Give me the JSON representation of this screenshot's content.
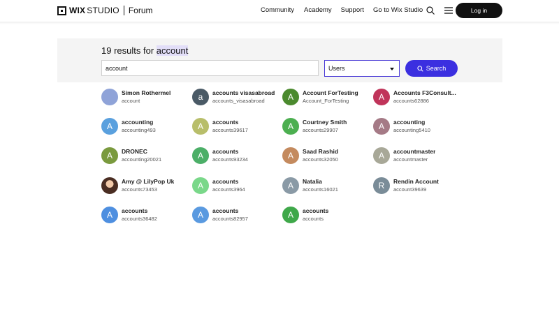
{
  "header": {
    "logo_wix": "WIX",
    "logo_studio": "STUDIO",
    "logo_forum": "Forum",
    "nav": [
      "Community",
      "Academy",
      "Support",
      "Go to Wix Studio"
    ],
    "login_label": "Log in"
  },
  "search": {
    "results_prefix": "19 results for",
    "query_highlight": "account",
    "input_value": "account",
    "select_value": "Users",
    "button_label": "Search"
  },
  "users": [
    {
      "initial": "",
      "name": "Simon Rothermel",
      "handle": "account",
      "color": "#8fa3d8"
    },
    {
      "initial": "a",
      "name": "accounts visasabroad",
      "handle": "accounts_visasabroad",
      "color": "#4a5a66"
    },
    {
      "initial": "A",
      "name": "Account ForTesting",
      "handle": "Account_ForTesting",
      "color": "#4b8a2e"
    },
    {
      "initial": "A",
      "name": "Accounts F3Consult...",
      "handle": "accounts62886",
      "color": "#c0345a"
    },
    {
      "initial": "A",
      "name": "accounting",
      "handle": "accounting493",
      "color": "#5aa0de"
    },
    {
      "initial": "A",
      "name": "accounts",
      "handle": "accounts39617",
      "color": "#b8be6a"
    },
    {
      "initial": "A",
      "name": "Courtney Smith",
      "handle": "accounts29907",
      "color": "#4caf50"
    },
    {
      "initial": "A",
      "name": "accounting",
      "handle": "accounting5410",
      "color": "#a57a86"
    },
    {
      "initial": "A",
      "name": "DRONEC",
      "handle": "accounting20021",
      "color": "#7a9a3e"
    },
    {
      "initial": "A",
      "name": "accounts",
      "handle": "accounts93234",
      "color": "#4caf68"
    },
    {
      "initial": "A",
      "name": "Saad Rashid",
      "handle": "accounts32050",
      "color": "#c48a5e"
    },
    {
      "initial": "A",
      "name": "accountmaster",
      "handle": "accountmaster",
      "color": "#a8a898"
    },
    {
      "initial": "",
      "name": "Amy @ LilyPop Uk",
      "handle": "accounts73453",
      "color": "photo"
    },
    {
      "initial": "A",
      "name": "accounts",
      "handle": "accounts3964",
      "color": "#7ad88a"
    },
    {
      "initial": "A",
      "name": "Natalia",
      "handle": "accounts16021",
      "color": "#8a9aa6"
    },
    {
      "initial": "R",
      "name": "Rendin Account",
      "handle": "account39639",
      "color": "#7a8c98"
    },
    {
      "initial": "A",
      "name": "accounts",
      "handle": "accounts36482",
      "color": "#4e8fe0"
    },
    {
      "initial": "A",
      "name": "accounts",
      "handle": "accounts82957",
      "color": "#5a9ae0"
    },
    {
      "initial": "A",
      "name": "accounts",
      "handle": "accounts",
      "color": "#3fa84a"
    }
  ]
}
